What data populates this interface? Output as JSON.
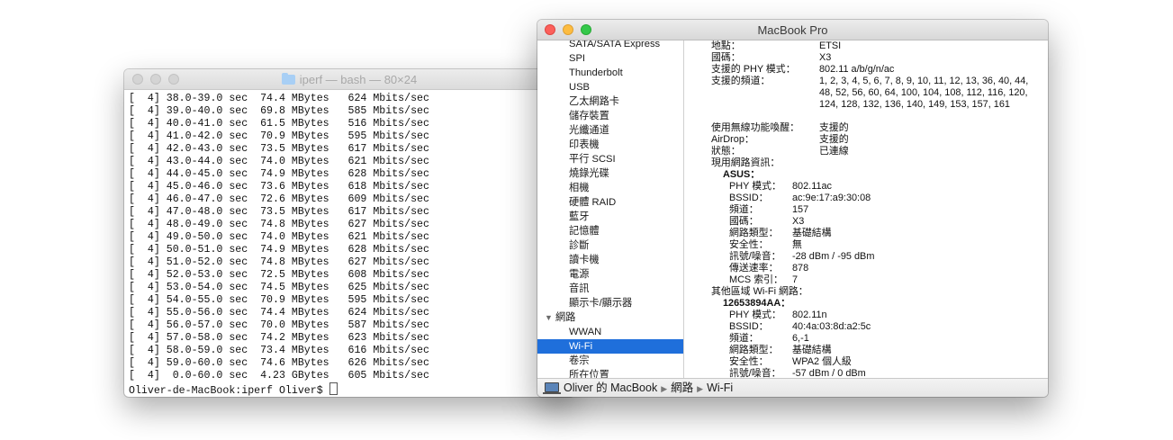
{
  "terminal": {
    "title": "iperf — bash — 80×24",
    "lines": [
      "[  4] 38.0-39.0 sec  74.4 MBytes   624 Mbits/sec",
      "[  4] 39.0-40.0 sec  69.8 MBytes   585 Mbits/sec",
      "[  4] 40.0-41.0 sec  61.5 MBytes   516 Mbits/sec",
      "[  4] 41.0-42.0 sec  70.9 MBytes   595 Mbits/sec",
      "[  4] 42.0-43.0 sec  73.5 MBytes   617 Mbits/sec",
      "[  4] 43.0-44.0 sec  74.0 MBytes   621 Mbits/sec",
      "[  4] 44.0-45.0 sec  74.9 MBytes   628 Mbits/sec",
      "[  4] 45.0-46.0 sec  73.6 MBytes   618 Mbits/sec",
      "[  4] 46.0-47.0 sec  72.6 MBytes   609 Mbits/sec",
      "[  4] 47.0-48.0 sec  73.5 MBytes   617 Mbits/sec",
      "[  4] 48.0-49.0 sec  74.8 MBytes   627 Mbits/sec",
      "[  4] 49.0-50.0 sec  74.0 MBytes   621 Mbits/sec",
      "[  4] 50.0-51.0 sec  74.9 MBytes   628 Mbits/sec",
      "[  4] 51.0-52.0 sec  74.8 MBytes   627 Mbits/sec",
      "[  4] 52.0-53.0 sec  72.5 MBytes   608 Mbits/sec",
      "[  4] 53.0-54.0 sec  74.5 MBytes   625 Mbits/sec",
      "[  4] 54.0-55.0 sec  70.9 MBytes   595 Mbits/sec",
      "[  4] 55.0-56.0 sec  74.4 MBytes   624 Mbits/sec",
      "[  4] 56.0-57.0 sec  70.0 MBytes   587 Mbits/sec",
      "[  4] 57.0-58.0 sec  74.2 MBytes   623 Mbits/sec",
      "[  4] 58.0-59.0 sec  73.4 MBytes   616 Mbits/sec",
      "[  4] 59.0-60.0 sec  74.6 MBytes   626 Mbits/sec",
      "[  4]  0.0-60.0 sec  4.23 GBytes   605 Mbits/sec"
    ],
    "prompt": "Oliver-de-MacBook:iperf Oliver$ "
  },
  "sysinfo": {
    "title": "MacBook Pro",
    "sidebar": [
      "SATA/SATA Express",
      "SPI",
      "Thunderbolt",
      "USB",
      "乙太網路卡",
      "儲存裝置",
      "光纖通道",
      "印表機",
      "平行 SCSI",
      "燒錄光碟",
      "相機",
      "硬體 RAID",
      "藍牙",
      "記憶體",
      "診斷",
      "讀卡機",
      "電源",
      "音訊",
      "顯示卡/顯示器"
    ],
    "network_group": "網路",
    "network_children": [
      "WWAN",
      "Wi-Fi",
      "卷宗",
      "所在位置"
    ],
    "selected": "Wi-Fi",
    "detail": {
      "location_label": "地點：",
      "location": "ETSI",
      "country_label": "國碼：",
      "country": "X3",
      "phy_label": "支援的 PHY 模式：",
      "phy": "802.11 a/b/g/n/ac",
      "channels_label": "支援的頻道：",
      "channels": "1, 2, 3, 4, 5, 6, 7, 8, 9, 10, 11, 12, 13, 36, 40, 44, 48, 52, 56, 60, 64, 100, 104, 108, 112, 116, 120, 124, 128, 132, 136, 140, 149, 153, 157, 161",
      "wake_label": "使用無線功能喚醒：",
      "wake": "支援的",
      "airdrop_label": "AirDrop：",
      "airdrop": "支援的",
      "status_label": "狀態：",
      "status": "已連線",
      "current_label": "現用網路資訊：",
      "current_name": "ASUS：",
      "current": [
        {
          "label": "PHY 模式：",
          "value": "802.11ac"
        },
        {
          "label": "BSSID：",
          "value": "ac:9e:17:a9:30:08"
        },
        {
          "label": "頻道：",
          "value": "157"
        },
        {
          "label": "國碼：",
          "value": "X3"
        },
        {
          "label": "網路類型：",
          "value": "基礎結構"
        },
        {
          "label": "安全性：",
          "value": "無"
        },
        {
          "label": "訊號/噪音：",
          "value": "-28 dBm / -95 dBm"
        },
        {
          "label": "傳送速率：",
          "value": "878"
        },
        {
          "label": "MCS 索引：",
          "value": "7"
        }
      ],
      "other_label": "其他區域 Wi-Fi 網路：",
      "other_name": "12653894AA：",
      "other": [
        {
          "label": "PHY 模式：",
          "value": "802.11n"
        },
        {
          "label": "BSSID：",
          "value": "40:4a:03:8d:a2:5c"
        },
        {
          "label": "頻道：",
          "value": "6,-1"
        },
        {
          "label": "網路類型：",
          "value": "基礎結構"
        },
        {
          "label": "安全性：",
          "value": "WPA2 個人級"
        },
        {
          "label": "訊號/噪音：",
          "value": "-57 dBm / 0 dBm"
        }
      ]
    },
    "pathbar": {
      "computer": "Oliver 的 MacBook",
      "section": "網路",
      "item": "Wi-Fi"
    }
  }
}
